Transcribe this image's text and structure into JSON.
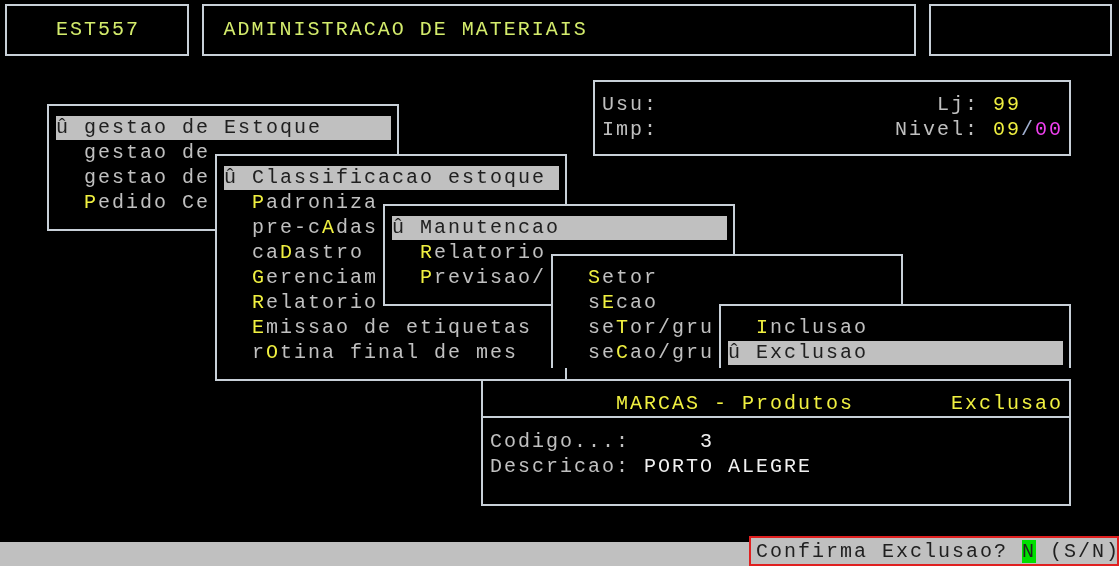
{
  "header": {
    "code": "EST557",
    "title": "ADMINISTRACAO DE MATERIAIS"
  },
  "info": {
    "user_label": "Usu:",
    "store_label": "Lj:",
    "store_value": "99",
    "printer_label": "Imp:",
    "level_label": "Nivel:",
    "level_value": "09",
    "level_separator": "/",
    "level_sub": "00"
  },
  "menus": [
    {
      "items": [
        {
          "marker": "û",
          "rest": "gestao de Estoque",
          "selected": true
        },
        {
          "rest": "gestao de",
          "selected": false
        },
        {
          "rest": "gestao de",
          "selected": false
        },
        {
          "hotkey": "P",
          "rest": "edido Ce",
          "selected": false
        }
      ]
    },
    {
      "items": [
        {
          "marker": "û",
          "rest": "Classificacao estoque",
          "selected": true
        },
        {
          "hotkey": "P",
          "rest": "adroniza",
          "selected": false
        },
        {
          "prefix": "pre-c",
          "hotkey": "A",
          "rest": "das",
          "selected": false
        },
        {
          "prefix": "ca",
          "hotkey": "D",
          "rest": "astro",
          "selected": false
        },
        {
          "hotkey": "G",
          "rest": "erenciam",
          "selected": false
        },
        {
          "hotkey": "R",
          "rest": "elatorio",
          "selected": false
        },
        {
          "hotkey": "E",
          "rest": "missao de etiquetas",
          "selected": false
        },
        {
          "prefix": "r",
          "hotkey": "O",
          "rest": "tina final de mes",
          "selected": false
        }
      ]
    },
    {
      "items": [
        {
          "marker": "û",
          "rest": "Manutencao",
          "selected": true
        },
        {
          "hotkey": "R",
          "rest": "elatorio",
          "selected": false
        },
        {
          "hotkey": "P",
          "rest": "revisao/",
          "selected": false
        }
      ]
    },
    {
      "items": [
        {
          "hotkey": "S",
          "rest": "etor",
          "selected": false
        },
        {
          "prefix": "s",
          "hotkey": "E",
          "rest": "cao",
          "selected": false
        },
        {
          "prefix": "se",
          "hotkey": "T",
          "rest": "or/gru",
          "selected": false
        },
        {
          "prefix": "se",
          "hotkey": "C",
          "rest": "ao/gru",
          "selected": false
        }
      ]
    },
    {
      "items": [
        {
          "hotkey": "I",
          "rest": "nclusao",
          "selected": false
        },
        {
          "marker": "û",
          "rest": "Exclusao",
          "selected": true
        }
      ]
    }
  ],
  "form": {
    "title": "MARCAS - Produtos",
    "mode": "Exclusao",
    "fields": [
      {
        "label": "Codigo...:",
        "value": "3",
        "kind": "number"
      },
      {
        "label": "Descricao:",
        "value": "PORTO ALEGRE",
        "kind": "text"
      }
    ]
  },
  "prompt": {
    "question": "Confirma Exclusao?",
    "answer": "N",
    "options": "(S/N)"
  }
}
